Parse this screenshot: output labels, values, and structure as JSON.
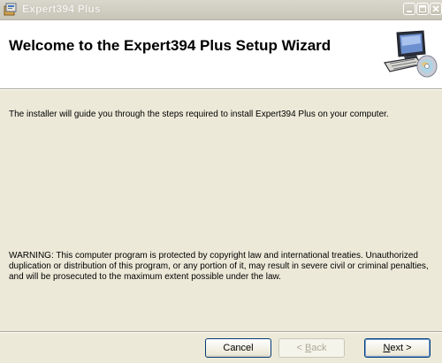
{
  "window": {
    "title": "Expert394 Plus",
    "icon": "installer-icon",
    "controls": [
      "minimize-icon",
      "maximize-icon",
      "close-icon"
    ]
  },
  "header": {
    "title": "Welcome to the Expert394 Plus Setup Wizard",
    "graphic": "computer-with-disc-icon"
  },
  "body": {
    "intro": "The installer will guide you through the steps required to install Expert394 Plus on your computer.",
    "warning": "WARNING: This computer program is protected by copyright law and international treaties. Unauthorized duplication or distribution of this program, or any portion of it, may result in severe civil or criminal penalties, and will be prosecuted to the maximum extent possible under the law."
  },
  "buttons": {
    "cancel": "Cancel",
    "back_prefix": "< ",
    "back_mnemonic": "B",
    "back_rest": "ack",
    "next_mnemonic": "N",
    "next_rest": "ext >"
  }
}
